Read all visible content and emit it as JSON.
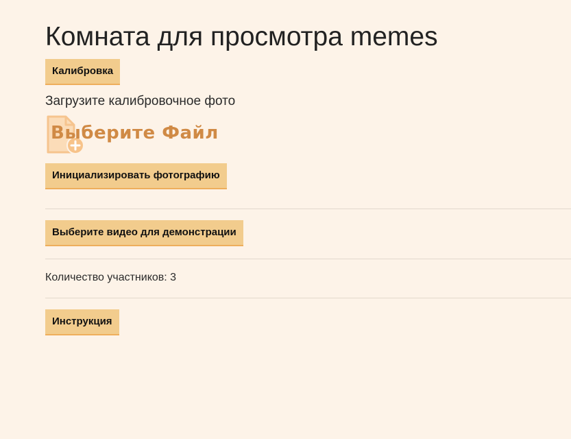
{
  "title": "Комната для просмотра memes",
  "calibration_button": "Калибровка",
  "upload_label": "Загрузите калибровочное фото",
  "file_picker": {
    "label": "Выберите Файл",
    "icon": "file-add-icon"
  },
  "init_photo_button": "Инициализировать фотографию",
  "select_video_button": "Выберите видео для демонстрации",
  "participants": "Количество участников: 3",
  "instruction_button": "Инструкция",
  "colors": {
    "background": "#fdf3e8",
    "button": "#f2cc8d",
    "button_border": "#eeae5c",
    "accent": "#d08a45"
  }
}
